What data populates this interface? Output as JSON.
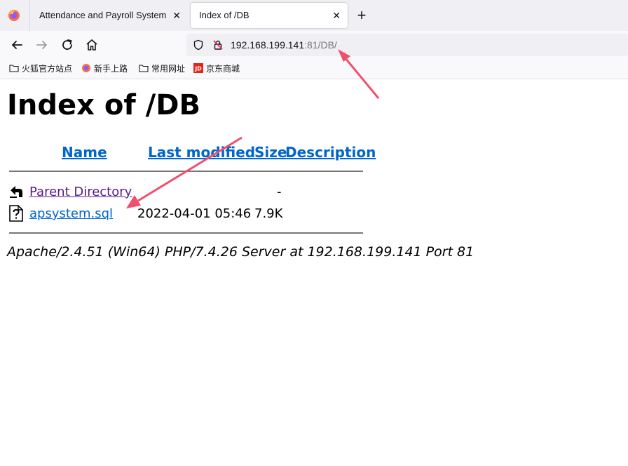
{
  "browser": {
    "tabs": [
      {
        "label": "Attendance and Payroll System",
        "active": false
      },
      {
        "label": "Index of /DB",
        "active": true
      }
    ],
    "url": {
      "host": "192.168.199.141",
      "rest": ":81/DB/"
    },
    "bookmarks": [
      {
        "label": "火狐官方站点",
        "icon": "folder-icon"
      },
      {
        "label": "新手上路",
        "icon": "firefox-icon"
      },
      {
        "label": "常用网址",
        "icon": "folder-icon"
      },
      {
        "label": "京东商城",
        "icon": "jd-icon"
      }
    ],
    "jd_logo_text": "JD"
  },
  "page": {
    "title": "Index of /DB",
    "columns": {
      "name": "Name",
      "last_modified": "Last modified",
      "size": "Size",
      "description": "Description"
    },
    "rows": [
      {
        "name": "Parent Directory",
        "modified": "",
        "size": "-",
        "visited": true
      },
      {
        "name": "apsystem.sql",
        "modified": "2022-04-01 05:46",
        "size": "7.9K",
        "visited": false
      }
    ],
    "footer": "Apache/2.4.51 (Win64) PHP/7.4.26 Server at 192.168.199.141 Port 81"
  },
  "colors": {
    "link": "#0066cc",
    "visited": "#551a8b",
    "annotation": "#f0506e"
  }
}
